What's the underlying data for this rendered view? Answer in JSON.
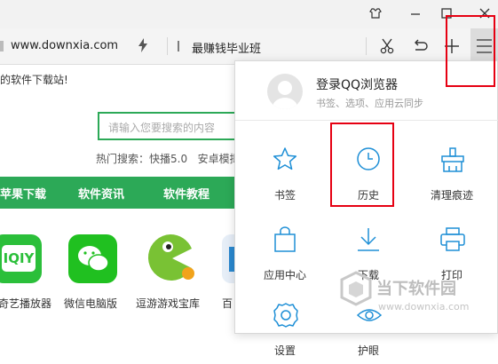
{
  "browser": {
    "url": "www.downxia.com",
    "search_term": "最赚钱毕业班"
  },
  "page": {
    "slogan": "的软件下载站!",
    "search_placeholder": "请输入您要搜索的内容",
    "hot_search_label": "热门搜索：",
    "hot_items": [
      "快播5.0",
      "安卓模拟"
    ],
    "nav": [
      "苹果下载",
      "软件资讯",
      "软件教程"
    ],
    "apps": [
      {
        "label": "奇艺播放器",
        "color": "#2bbf3a"
      },
      {
        "label": "微信电脑版",
        "color": "#20c020"
      },
      {
        "label": "逗游游戏宝库",
        "color": "#7ec43a"
      },
      {
        "label": "百",
        "color": "#2a88cf"
      }
    ]
  },
  "menu": {
    "login_title": "登录QQ浏览器",
    "login_subtitle": "书签、选项、应用云同步",
    "accent": "#1e8fd6",
    "items": [
      {
        "label": "书签",
        "icon": "star-icon"
      },
      {
        "label": "历史",
        "icon": "clock-icon"
      },
      {
        "label": "清理痕迹",
        "icon": "broom-icon"
      },
      {
        "label": "应用中心",
        "icon": "bag-icon"
      },
      {
        "label": "下载",
        "icon": "download-icon"
      },
      {
        "label": "打印",
        "icon": "printer-icon"
      },
      {
        "label": "设置",
        "icon": "gear-icon"
      },
      {
        "label": "护眼",
        "icon": "eye-icon"
      }
    ]
  },
  "watermark": {
    "name": "当下软件园",
    "url": "www.downxia.com"
  },
  "highlight_color": "#e60012"
}
